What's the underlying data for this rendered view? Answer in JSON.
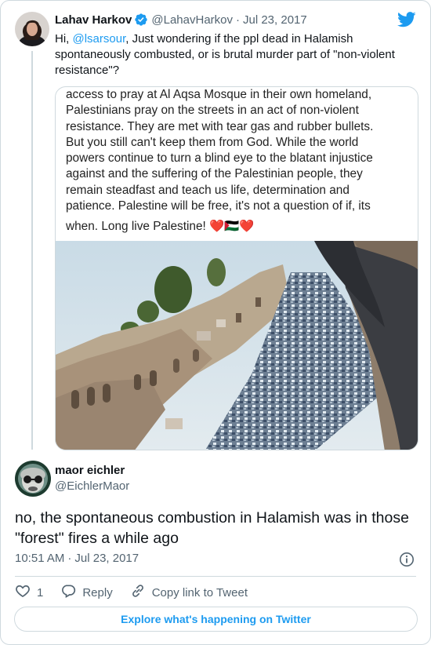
{
  "parent_tweet": {
    "author_name": "Lahav Harkov",
    "author_handle": "@LahavHarkov",
    "separator": "·",
    "date": "Jul 23, 2017",
    "text_before": "Hi, ",
    "mention": "@lsarsour",
    "text_after": ", Just wondering if the ppl dead in Halamish spontaneously combusted, or is brutal murder part of \"non-violent resistance\"?",
    "media_text_lines": [
      "access to pray at Al Aqsa Mosque in their own homeland,",
      "Palestinians pray on the streets in an act of non-violent",
      "resistance. They are met with tear gas and rubber bullets.",
      "But you still can't keep them from God. While the world",
      "powers continue to turn a blind eye to the blatant injustice",
      "against and the suffering of the Palestinian people, they",
      "remain steadfast and teach us life, determination and",
      "patience. Palestine will be free, it's not a question of if, its",
      "when. Long live Palestine! ❤️🇵🇸❤️"
    ]
  },
  "reply_tweet": {
    "author_name": "maor eichler",
    "author_handle": "@EichlerMaor",
    "text": "no, the spontaneous combustion in Halamish was in those \"forest\" fires a while ago",
    "time": "10:51 AM",
    "separator": "·",
    "date": "Jul 23, 2017"
  },
  "actions": {
    "like_count": "1",
    "reply_label": "Reply",
    "copy_link_label": "Copy link to Tweet"
  },
  "footer": {
    "explore_label": "Explore what's happening on Twitter"
  },
  "icons": {
    "verified": "verified-badge-icon",
    "brand": "twitter-bird-icon",
    "info": "info-icon",
    "like": "heart-icon",
    "reply": "reply-bubble-icon",
    "link": "link-icon"
  },
  "colors": {
    "accent": "#1d9bf0",
    "text": "#0f1419",
    "muted": "#536471",
    "border": "#cfd9de"
  }
}
